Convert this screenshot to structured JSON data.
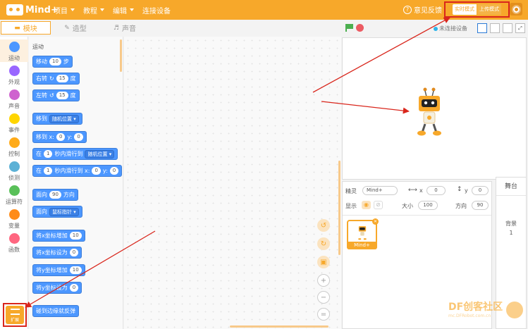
{
  "app": {
    "logo_text": "Mind+"
  },
  "menu": {
    "items": [
      "项目",
      "教程",
      "编辑",
      "连接设备"
    ]
  },
  "topbar": {
    "feedback": "意见反馈",
    "mode_realtime": "实时模式",
    "mode_upload": "上传模式"
  },
  "tabs": [
    "模块",
    "造型",
    "声音"
  ],
  "categories": [
    {
      "label": "运动",
      "color": "#4c97ff"
    },
    {
      "label": "外观",
      "color": "#9966ff"
    },
    {
      "label": "声音",
      "color": "#cf63cf"
    },
    {
      "label": "事件",
      "color": "#ffd500"
    },
    {
      "label": "控制",
      "color": "#ffab19"
    },
    {
      "label": "侦测",
      "color": "#5cb1d6"
    },
    {
      "label": "运算符",
      "color": "#59c059"
    },
    {
      "label": "变量",
      "color": "#ff8c1a"
    },
    {
      "label": "函数",
      "color": "#ff6680"
    }
  ],
  "extension": {
    "label": "扩展"
  },
  "palette": {
    "title": "运动",
    "move": {
      "a": "移动",
      "n": "10",
      "b": "步"
    },
    "turn_right": {
      "a": "右转",
      "n": "15",
      "b": "度"
    },
    "turn_left": {
      "a": "左转",
      "n": "15",
      "b": "度"
    },
    "goto": {
      "a": "移到",
      "d": "随机位置"
    },
    "goto_xy": {
      "a": "移到 x:",
      "x": "0",
      "b": "y:",
      "y": "0"
    },
    "glide": {
      "a": "在",
      "n": "1",
      "b": "秒内滑行到",
      "d": "随机位置"
    },
    "glide_xy": {
      "a": "在",
      "n": "1",
      "b": "秒内滑行到 x:",
      "x": "0",
      "c": "y:",
      "y": "0"
    },
    "point": {
      "a": "面向",
      "n": "90",
      "b": "方向"
    },
    "point_towards": {
      "a": "面向",
      "d": "鼠标指针"
    },
    "change_x": {
      "a": "将x坐标增加",
      "n": "10"
    },
    "set_x": {
      "a": "将x坐标设为",
      "n": "0"
    },
    "change_y": {
      "a": "将y坐标增加",
      "n": "10"
    },
    "set_y": {
      "a": "将y坐标设为",
      "n": "0"
    },
    "bounce": {
      "a": "碰到边缘就反弹"
    }
  },
  "stage_bar": {
    "status": "未连接设备"
  },
  "sprite": {
    "label": "精灵",
    "name": "Mind+",
    "x_label": "x",
    "x": "0",
    "y_label": "y",
    "y": "0",
    "show_label": "显示",
    "size_label": "大小",
    "size": "100",
    "dir_label": "方向",
    "dir": "90",
    "thumb_name": "Mind+"
  },
  "stage_panel": {
    "title": "舞台",
    "backdrop_label": "背景",
    "backdrop_count": "1"
  },
  "watermark": {
    "text": "DF创客社区",
    "sub": "mc.DFRobot.com.cn"
  },
  "colors": {
    "accent": "#f7a82a",
    "motion_block": "#4c97ff",
    "annotation": "#d9261c"
  }
}
